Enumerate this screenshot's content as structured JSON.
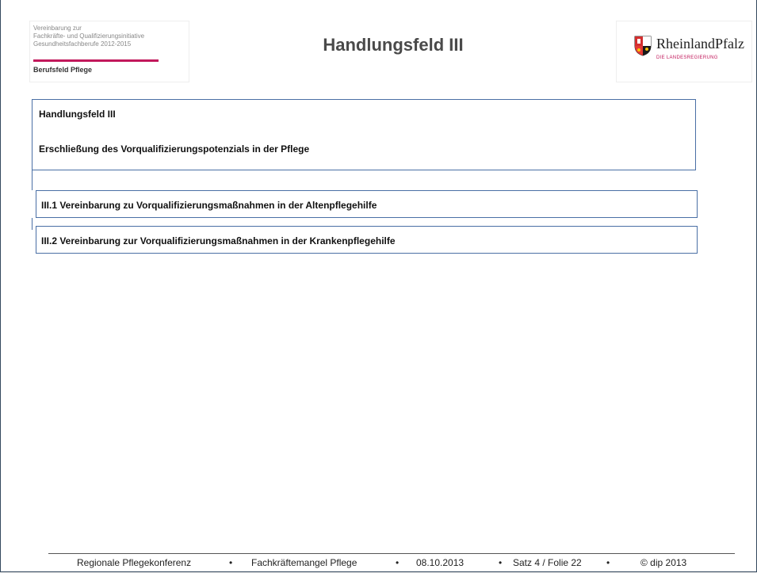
{
  "header": {
    "logo_left": {
      "line1": "Vereinbarung zur",
      "line2": "Fachkräfte- und Qualifizierungsinitiative",
      "line3": "Gesundheitsfachberufe 2012-2015",
      "sub": "Berufsfeld Pflege"
    },
    "title": "Handlungsfeld III",
    "logo_right": {
      "name": "RheinlandPfalz",
      "sub": "DIE LANDESREGIERUNG"
    }
  },
  "main_box": {
    "title": "Handlungsfeld III",
    "subtitle": "Erschließung des Vorqualifizierungspotenzials in der Pflege"
  },
  "items": [
    {
      "label": "III.1 Vereinbarung zu Vorqualifizierungsmaßnahmen in der Altenpflegehilfe"
    },
    {
      "label": "III.2 Vereinbarung zur Vorqualifizierungsmaßnahmen in der Krankenpflegehilfe"
    }
  ],
  "footer": {
    "event": "Regionale Pflegekonferenz",
    "topic": "Fachkräftemangel Pflege",
    "date": "08.10.2013",
    "slide": "Satz 4 /  Folie  22",
    "copyright": "© dip 2013",
    "separator": "•"
  },
  "colors": {
    "box_border": "#4a6fa5",
    "accent": "#c2185b",
    "title_text": "#4a4a4a"
  }
}
